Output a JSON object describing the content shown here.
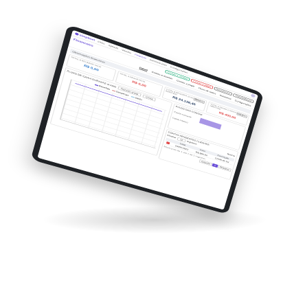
{
  "brand": {
    "name": "simplinet"
  },
  "nav": [
    "Início",
    "Agenda",
    "Vendas",
    "Finanças",
    "Administrativo",
    "Configurações"
  ],
  "page": {
    "title": "Financeiro"
  },
  "actions": {
    "receive": "Contas a receber",
    "pay": "Contas a pagar",
    "more": "Documentos",
    "transfer": "Transferências"
  },
  "tabs": [
    "Painel",
    "Contas a receber",
    "Contas a pagar",
    "Fluxo de Caixa",
    "Relatórios",
    "Configurações"
  ],
  "section": {
    "label": "Observações financeiras"
  },
  "cards": [
    {
      "label": "TOTAL A RECEBER HOJE",
      "value": "R$ 0,00"
    },
    {
      "label": "TOTAL A PAGAR HOJE",
      "value": "R$ 0,00"
    },
    {
      "label": "TOTAL A RECEBER (CONTAS ABERTAS)",
      "value": "R$ 24.136,45",
      "mini": "Detalhes"
    },
    {
      "label": "TOTAL A PAGAR (CONTAS ABERTAS)",
      "value": "R$ 400,00",
      "mini": "Detalhes"
    }
  ],
  "chart": {
    "title": "FLUXO DE CAIXA DURANTE O ANO",
    "filter1": "Receita anual",
    "filter2": "Conta",
    "legend": [
      "Receitas",
      "Despesas",
      "Saldo"
    ],
    "colors": {
      "a": "#6a4fd8",
      "b": "#e0a0a0",
      "c": "#9ecbe8"
    }
  },
  "side": {
    "chart_title": "SALDO DAS CONTAS",
    "row1": "Conta corrente",
    "row2": "Caixa interno",
    "table_title": "CONTAS PENDENTES CLIENTES",
    "show": "Mostrar",
    "entries": "registros",
    "search": "Buscar",
    "headers": [
      "Data",
      "Valor",
      "Descrição"
    ],
    "rows": [
      [
        "23/06/2022",
        "R$ 600,00",
        "Conta de luz"
      ]
    ],
    "footer": "Mostrando de 1 até 1 de 1 registros",
    "pages": [
      "Anterior",
      "1",
      "Próximo"
    ]
  }
}
